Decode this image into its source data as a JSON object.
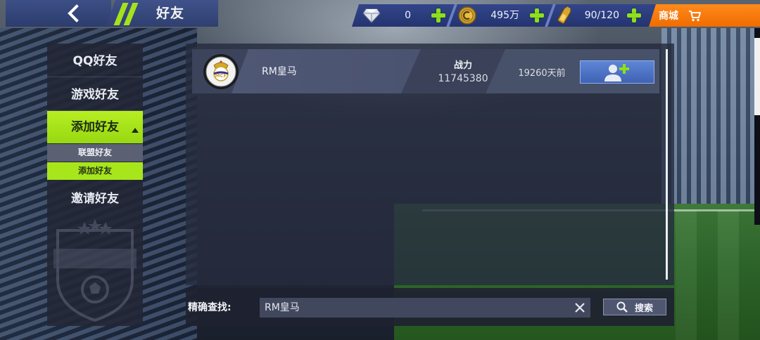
{
  "header": {
    "title": "好友",
    "back_icon": "chevron-left-icon"
  },
  "resources": {
    "diamond": {
      "icon": "diamond-icon",
      "value": "0"
    },
    "coin": {
      "icon": "coin-icon",
      "value": "495万"
    },
    "stamina": {
      "icon": "battery-icon",
      "value": "90/120"
    }
  },
  "shop": {
    "label": "商城",
    "icon": "cart-icon"
  },
  "colors": {
    "accent_green": "#a7e61b",
    "shop_orange": "#f07a0c",
    "panel_blue": "#2c3c6d"
  },
  "sidebar": {
    "items": [
      {
        "label": "QQ好友"
      },
      {
        "label": "游戏好友"
      },
      {
        "label": "添加好友"
      },
      {
        "label": "邀请好友"
      }
    ],
    "subitems": [
      {
        "label": "联盟好友"
      },
      {
        "label": "添加好友"
      }
    ]
  },
  "friend_list": [
    {
      "name": "RM皇马",
      "power_label": "战力",
      "power": "11745380",
      "last_online": "19260天前",
      "avatar_icon": "real-madrid-crest-icon",
      "action_icon": "add-friend-icon"
    }
  ],
  "search": {
    "label": "精确查找:",
    "value": "RM皇马",
    "button_label": "搜索"
  }
}
